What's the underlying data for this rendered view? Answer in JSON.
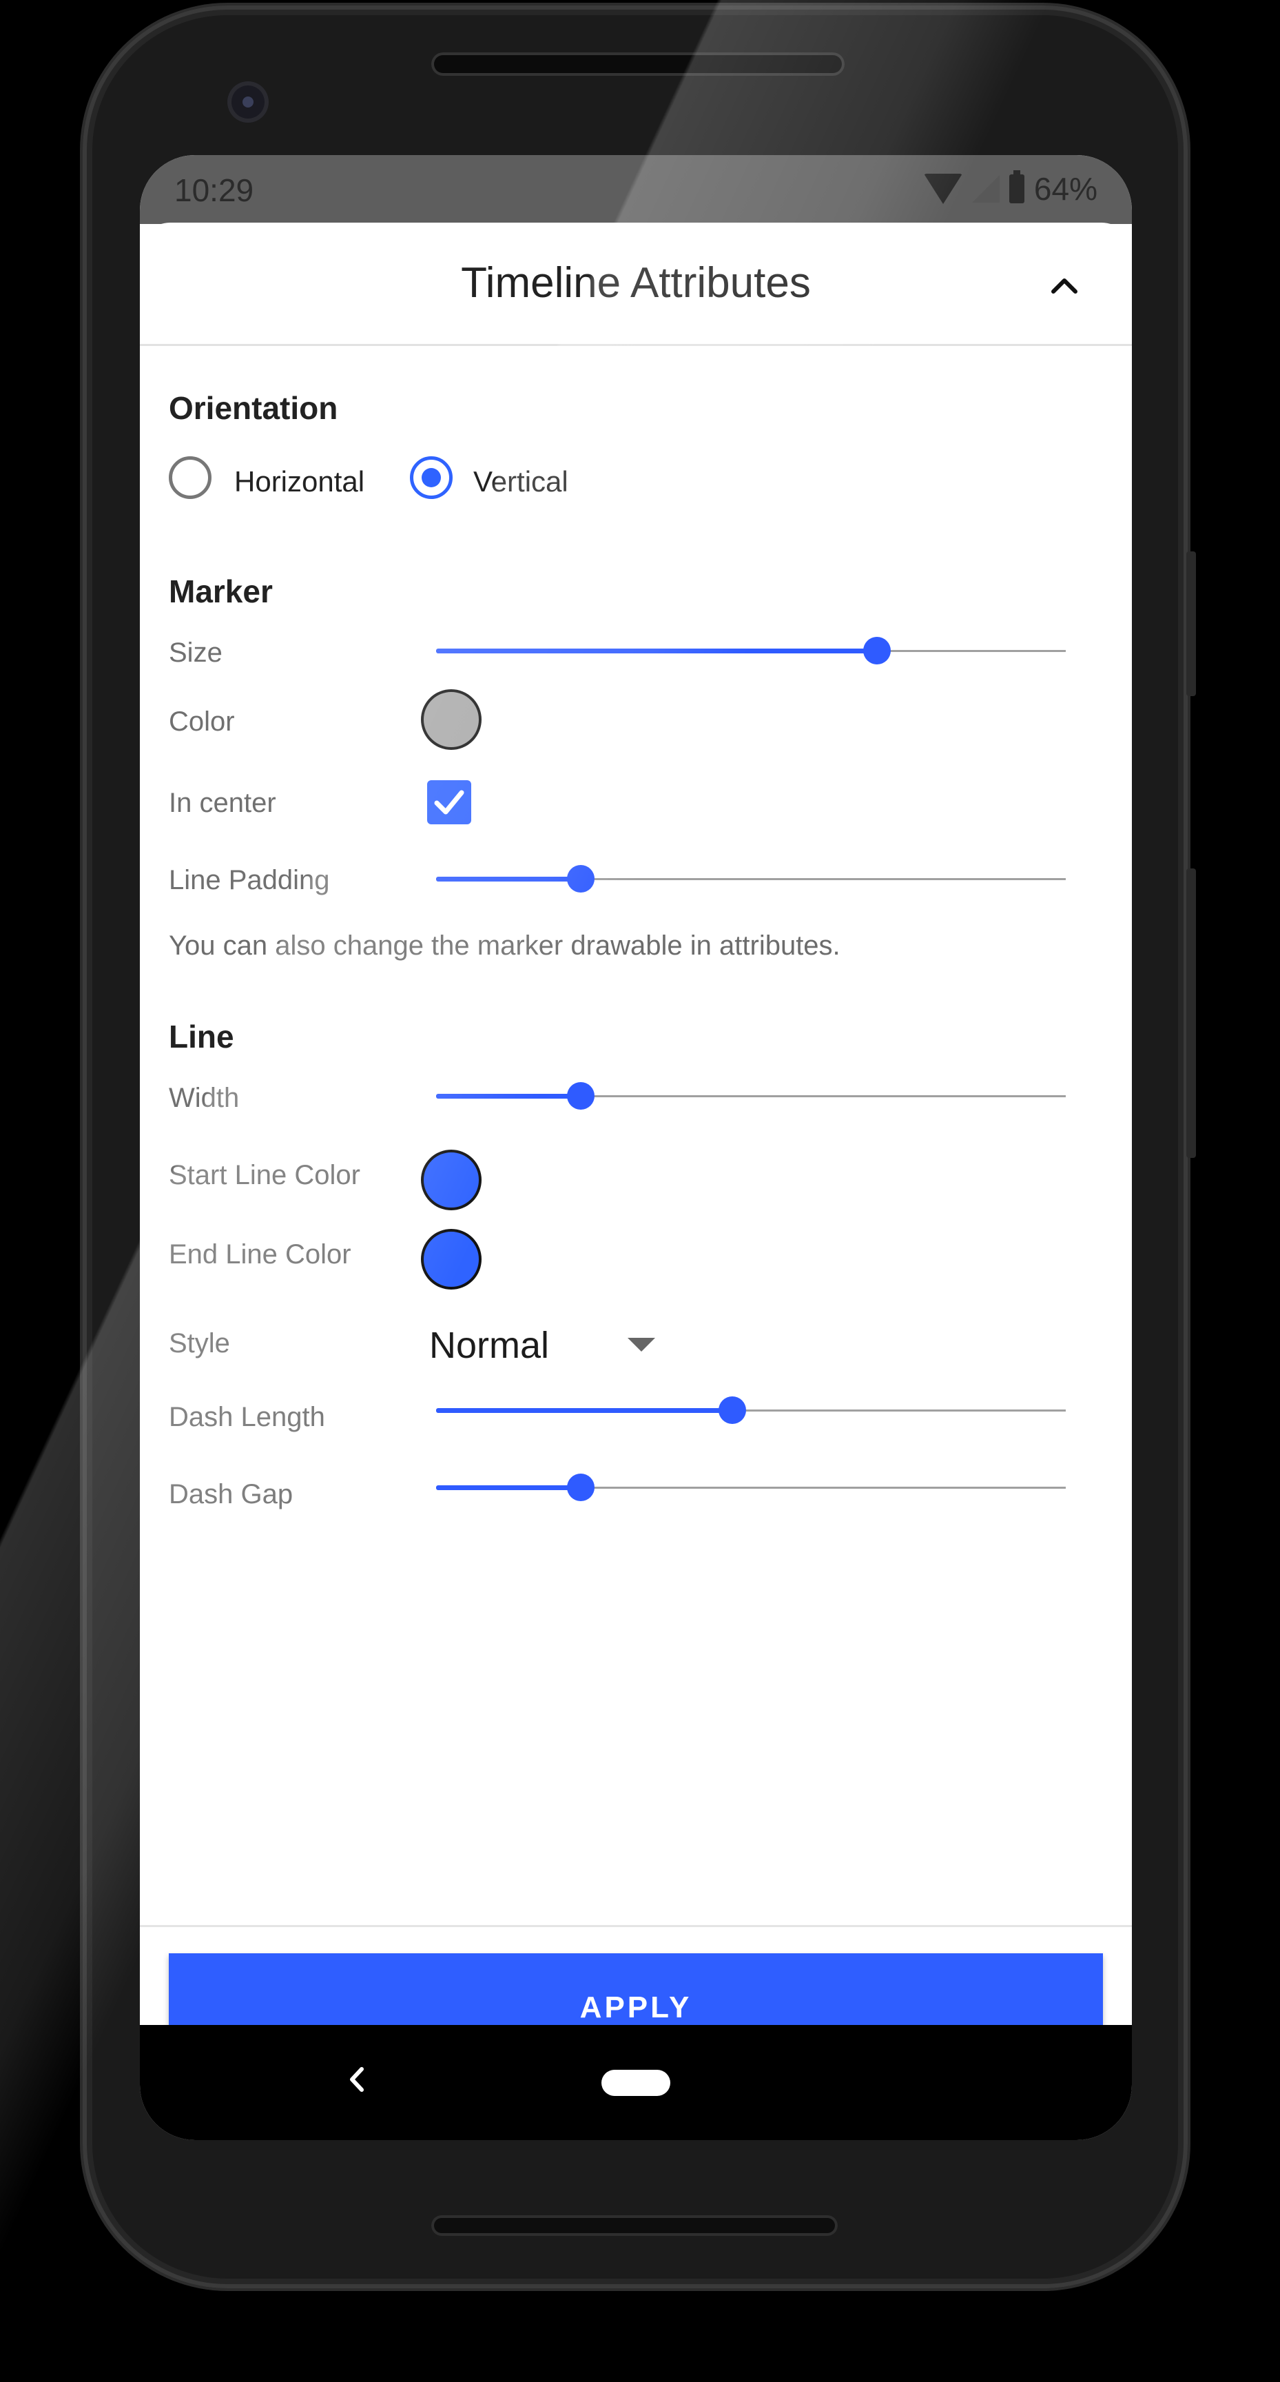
{
  "status_bar": {
    "time": "10:29",
    "battery": "64%"
  },
  "header": {
    "title": "Timeline Attributes"
  },
  "orientation": {
    "title": "Orientation",
    "options": [
      {
        "label": "Horizontal",
        "selected": false
      },
      {
        "label": "Vertical",
        "selected": true
      }
    ]
  },
  "marker": {
    "title": "Marker",
    "size": {
      "label": "Size",
      "value": 0.7
    },
    "color": {
      "label": "Color",
      "value": "#a7a7a7"
    },
    "in_center": {
      "label": "In center",
      "checked": true
    },
    "line_padding": {
      "label": "Line Padding",
      "value": 0.23
    },
    "info": "You can also change the marker drawable in attributes."
  },
  "line": {
    "title": "Line",
    "width": {
      "label": "Width",
      "value": 0.23
    },
    "start_color": {
      "label": "Start Line Color",
      "value": "#2f63ff"
    },
    "end_color": {
      "label": "End Line Color",
      "value": "#2f63ff"
    },
    "style": {
      "label": "Style",
      "value": "Normal"
    },
    "dash_length": {
      "label": "Dash Length",
      "value": 0.47
    },
    "dash_gap": {
      "label": "Dash Gap",
      "value": 0.23
    }
  },
  "apply_button": {
    "label": "APPLY"
  },
  "colors": {
    "accent": "#2f5eff",
    "marker_default": "#a7a7a7"
  }
}
